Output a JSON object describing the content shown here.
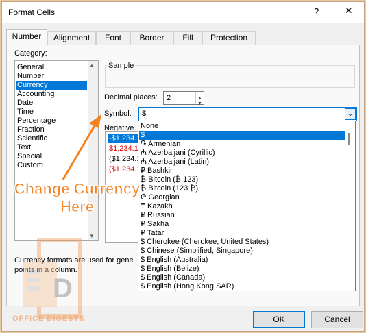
{
  "window": {
    "title": "Format Cells",
    "help": "?",
    "close": "✕"
  },
  "tabs": [
    "Number",
    "Alignment",
    "Font",
    "Border",
    "Fill",
    "Protection"
  ],
  "category": {
    "label": "Category:",
    "items": [
      "General",
      "Number",
      "Currency",
      "Accounting",
      "Date",
      "Time",
      "Percentage",
      "Fraction",
      "Scientific",
      "Text",
      "Special",
      "Custom"
    ],
    "selected": "Currency"
  },
  "sample": {
    "label": "Sample"
  },
  "decimal": {
    "label": "Decimal places:",
    "value": "2"
  },
  "symbol": {
    "label": "Symbol:",
    "value": "$"
  },
  "negative": {
    "label": "Negative",
    "items": [
      {
        "text": "-$1,234.1",
        "color": "#ffffff",
        "selected": true
      },
      {
        "text": "$1,234.1",
        "color": "#e00000",
        "selected": false
      },
      {
        "text": "($1,234.1",
        "color": "#000000",
        "selected": false
      },
      {
        "text": "($1,234.1",
        "color": "#e00000",
        "selected": false
      }
    ]
  },
  "description": {
    "line1": "Currency formats are used for gene",
    "line2": "points in a column."
  },
  "dropdown": {
    "items": [
      "None",
      "$",
      "֏ Armenian",
      "₼ Azerbaijani (Cyrillic)",
      "₼ Azerbaijani (Latin)",
      "₽ Bashkir",
      "₿ Bitcoin (₿ 123)",
      "₿ Bitcoin (123 ₿)",
      "₾ Georgian",
      "₸ Kazakh",
      "₽ Russian",
      "₽ Sakha",
      "₽ Tatar",
      "$ Cherokee (Cherokee, United States)",
      "$ Chinese (Simplified, Singapore)",
      "$ English (Australia)",
      "$ English (Belize)",
      "$ English (Canada)",
      "$ English (Hong Kong SAR)"
    ],
    "selected_index": 1
  },
  "buttons": {
    "ok": "OK",
    "cancel": "Cancel"
  },
  "annotation": {
    "line1": "Change Currency",
    "line2": "Here",
    "color": "#f58220"
  },
  "watermark": {
    "text": "OFFICE DIGESTS",
    "letter": "D"
  }
}
